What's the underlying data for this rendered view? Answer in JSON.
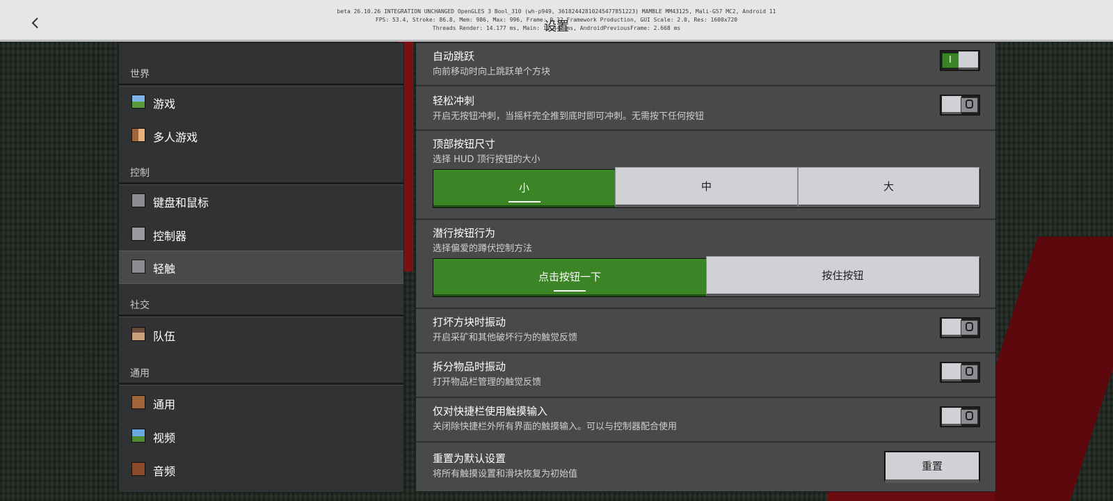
{
  "header": {
    "title": "设置",
    "back_icon": "chevron-left-icon",
    "debug_lines": [
      "beta 26.10.26 INTEGRATION UNCHANGED OpenGLES 3 Bool_310 (wh-p949, 36182442810245477851223) MAMBLE MM43125, Mali-G57 MC2, Android 11",
      "FPS: 53.4, Stroke: 86.8, Mem: 986, Max: 996, Frame: 0.32 Framework Production, GUI Scale: 2.0, Res: 1600x720",
      "Threads Render: 14.177 ms, Main: 13.442 ms, AndroidPreviousFrame: 2.668 ms"
    ]
  },
  "sidebar": {
    "sections": [
      {
        "title": "世界",
        "items": [
          {
            "label": "游戏",
            "icon": "grass-block-icon"
          },
          {
            "label": "多人游戏",
            "icon": "players-icon"
          }
        ]
      },
      {
        "title": "控制",
        "items": [
          {
            "label": "键盘和鼠标",
            "icon": "keyboard-mouse-icon"
          },
          {
            "label": "控制器",
            "icon": "controller-icon"
          },
          {
            "label": "轻触",
            "icon": "touch-hand-icon",
            "active": true
          }
        ]
      },
      {
        "title": "社交",
        "items": [
          {
            "label": "队伍",
            "icon": "party-icon"
          }
        ]
      },
      {
        "title": "通用",
        "items": [
          {
            "label": "通用",
            "icon": "gear-icon"
          },
          {
            "label": "视频",
            "icon": "landscape-icon"
          },
          {
            "label": "音频",
            "icon": "note-block-icon"
          }
        ]
      }
    ]
  },
  "settings": {
    "auto_jump": {
      "title": "自动跳跃",
      "desc": "向前移动时向上跳跃单个方块",
      "on": true,
      "on_mark": "I"
    },
    "easy_sprint": {
      "title": "轻松冲刺",
      "desc": "开启无按钮冲刺，当摇杆完全推到底时即可冲刺。无需按下任何按钮",
      "on": false
    },
    "top_button_size": {
      "title": "顶部按钮尺寸",
      "desc": "选择 HUD 顶行按钮的大小",
      "options": [
        "小",
        "中",
        "大"
      ],
      "selected": "小"
    },
    "sneak_behavior": {
      "title": "潜行按钮行为",
      "desc": "选择偏爱的蹲伏控制方法",
      "options": [
        "点击按钮一下",
        "按住按钮"
      ],
      "selected": "点击按钮一下"
    },
    "break_vibration": {
      "title": "打坏方块时振动",
      "desc": "开启采矿和其他破坏行为的触觉反馈",
      "on": false
    },
    "split_vibration": {
      "title": "拆分物品时振动",
      "desc": "打开物品栏管理的触觉反馈",
      "on": false
    },
    "hotbar_touch_only": {
      "title": "仅对快捷栏使用触摸输入",
      "desc": "关闭除快捷栏外所有界面的触摸输入。可以与控制器配合使用",
      "on": false
    },
    "reset": {
      "title": "重置为默认设置",
      "desc": "将所有触摸设置和滑块恢复为初始值",
      "button": "重置"
    }
  },
  "colors": {
    "accent_green": "#3c8527",
    "panel": "#48494a",
    "sidebar": "#313233"
  }
}
